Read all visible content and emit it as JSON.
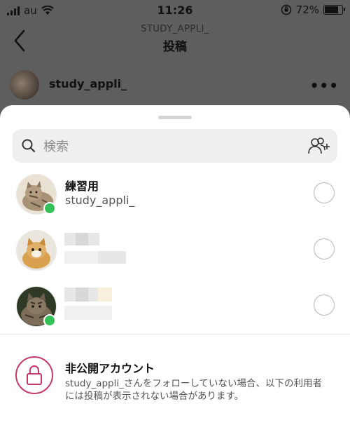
{
  "status_bar": {
    "carrier": "au",
    "time": "11:26",
    "battery": "72%",
    "battery_level": 0.72
  },
  "header": {
    "username_caps": "STUDY_APPLI_",
    "title": "投稿"
  },
  "post": {
    "username": "study_appli_"
  },
  "sheet": {
    "search": {
      "placeholder": "検索"
    },
    "recipients": [
      {
        "name": "練習用",
        "subtitle": "study_appli_",
        "online": true
      },
      {
        "name": "",
        "subtitle": "",
        "online": false
      },
      {
        "name": "",
        "subtitle": "",
        "online": true
      }
    ],
    "private_notice": {
      "title": "非公開アカウント",
      "description": "study_appli_さんをフォローしていない場合、以下の利用者には投稿が表示されない場合があります。"
    }
  },
  "colors": {
    "online": "#35c25a",
    "lock_accent": "#c6386d"
  }
}
